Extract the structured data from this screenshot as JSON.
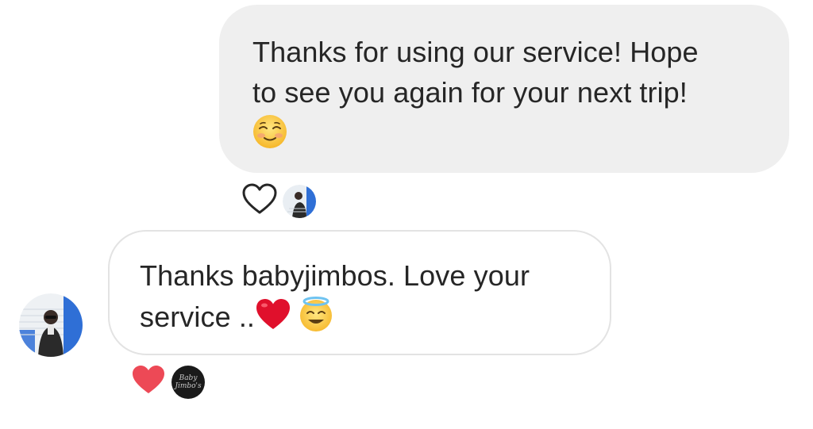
{
  "conversation": {
    "outgoing": {
      "text": "Thanks for using our service! Hope\nto see you again for your next trip!",
      "emoji": "smiling-face-with-smiling-eyes",
      "reactions": [
        "heart-outline-icon",
        "avatar"
      ]
    },
    "incoming": {
      "text": "Thanks babyjimbos. Love your\nservice ..",
      "emojis": [
        "red-heart",
        "smiling-face-with-halo"
      ],
      "reactions": [
        "heart-filled-icon",
        "brand-avatar"
      ],
      "brand_avatar_text_line1": "Baby",
      "brand_avatar_text_line2": "Jimbo's"
    }
  },
  "colors": {
    "outgoing_bubble": "#efefef",
    "incoming_bubble_border": "#e3e3e3",
    "text": "#262626",
    "heart_red": "#ed4956"
  }
}
